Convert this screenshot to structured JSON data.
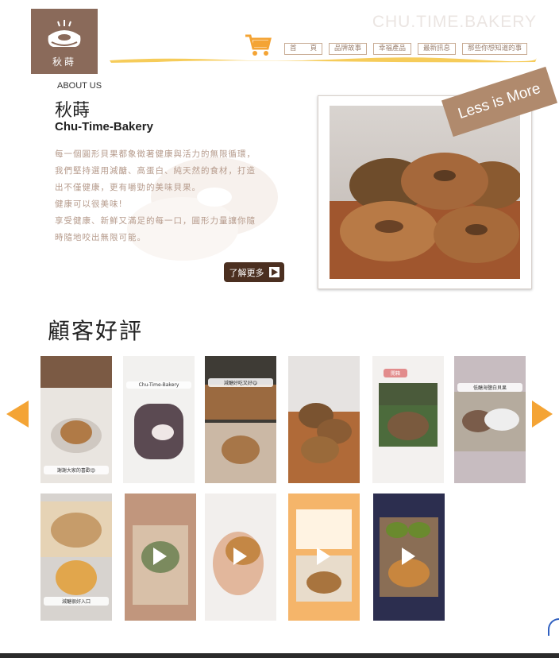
{
  "brand": {
    "logo_text": "秋蒔",
    "watermark": "CHU.TIME.BAKERY"
  },
  "nav": {
    "items": [
      "首　　頁",
      "品牌故事",
      "幸福產品",
      "最新訊息",
      "那些你想知道的事"
    ]
  },
  "about": {
    "label": "ABOUT US",
    "title": "秋蒔",
    "subtitle": "Chu-Time-Bakery",
    "body": [
      "每一個圓形貝果都象徵著健康與活力的無限循環，",
      "我們堅持選用減醣、高蛋白、純天然的食材，打造",
      "出不僅健康，更有嚼勁的美味貝果。",
      "健康可以很美味!",
      "享受健康、新鮮又滿足的每一口，圓形力量讓你隨",
      "時隨地咬出無限可能。"
    ],
    "more_button": "了解更多",
    "ribbon": "Less is More"
  },
  "reviews": {
    "title": "顧客好評",
    "cards": [
      {
        "caption": "謝謝大家的喜歡😍"
      },
      {
        "caption": "Chu-Time-Bakery"
      },
      {
        "caption": "減醣好吃又好😋"
      },
      {
        "caption": ""
      },
      {
        "caption": "開箱"
      },
      {
        "caption": "低醣海鹽白貝果"
      },
      {
        "caption": "減醣很好入口"
      },
      {
        "caption": ""
      },
      {
        "caption": ""
      },
      {
        "caption": ""
      },
      {
        "caption": ""
      }
    ]
  },
  "colors": {
    "accent": "#f4a435",
    "brand_brown": "#8a6a5a",
    "button_dark": "#4b2f20"
  }
}
